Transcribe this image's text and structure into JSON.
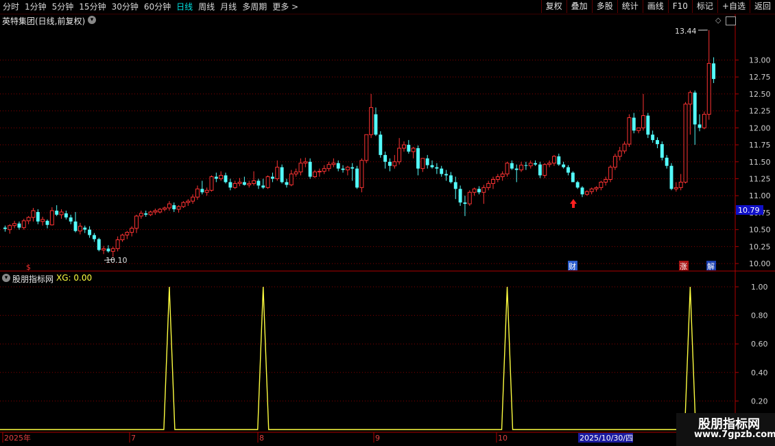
{
  "toolbar": {
    "periods": [
      "分时",
      "1分钟",
      "5分钟",
      "15分钟",
      "30分钟",
      "60分钟",
      "日线",
      "周线",
      "月线",
      "多周期",
      "更多 >"
    ],
    "active_period": "日线",
    "buttons": [
      "复权",
      "叠加",
      "多股",
      "统计",
      "画线",
      "F10",
      "标记",
      "+自选",
      "返回"
    ]
  },
  "stock": {
    "title": "英特集团(日线,前复权)"
  },
  "price_axis": {
    "ticks": [
      "13.00",
      "12.75",
      "12.50",
      "12.25",
      "12.00",
      "11.75",
      "11.50",
      "11.25",
      "11.00",
      "10.75",
      "10.50",
      "10.25",
      "10.00"
    ],
    "current": "10.79"
  },
  "annotations": {
    "high_label": "13.44",
    "low_label": "10.10"
  },
  "markers": [
    "财",
    "涨",
    "解"
  ],
  "red_icon_glyph": "$",
  "indicator": {
    "name": "股朋指标网",
    "xg_label": "XG: 0.00",
    "ticks": [
      "1.00",
      "0.80",
      "0.60",
      "0.40",
      "0.20"
    ]
  },
  "time_axis": {
    "labels": [
      "2025年",
      "7",
      "8",
      "9",
      "10"
    ],
    "selected_date": "2025/10/30/四"
  },
  "watermark": {
    "line1": "股朋指标网",
    "line2": "www.7gpzb.com"
  },
  "colors": {
    "up": "#ff3333",
    "down": "#54fcfc",
    "indicator": "#ffff40",
    "grid": "#8b0000",
    "bg": "#000000"
  },
  "chart_data": {
    "type": "candlestick",
    "price_range": [
      9.9,
      13.5
    ],
    "indicator_range": [
      0,
      1
    ],
    "indicator_spikes": [
      35,
      55,
      107,
      146
    ],
    "candles": [
      [
        10.53,
        10.56,
        10.47,
        10.51
      ],
      [
        10.5,
        10.58,
        10.44,
        10.56
      ],
      [
        10.56,
        10.63,
        10.52,
        10.59
      ],
      [
        10.59,
        10.62,
        10.5,
        10.53
      ],
      [
        10.53,
        10.66,
        10.5,
        10.63
      ],
      [
        10.63,
        10.7,
        10.58,
        10.68
      ],
      [
        10.68,
        10.82,
        10.62,
        10.78
      ],
      [
        10.76,
        10.8,
        10.58,
        10.62
      ],
      [
        10.62,
        10.69,
        10.56,
        10.65
      ],
      [
        10.63,
        10.65,
        10.52,
        10.57
      ],
      [
        10.57,
        10.83,
        10.56,
        10.78
      ],
      [
        10.78,
        10.86,
        10.7,
        10.72
      ],
      [
        10.72,
        10.8,
        10.66,
        10.76
      ],
      [
        10.74,
        10.78,
        10.65,
        10.68
      ],
      [
        10.68,
        10.72,
        10.58,
        10.62
      ],
      [
        10.62,
        10.76,
        10.46,
        10.48
      ],
      [
        10.48,
        10.6,
        10.43,
        10.55
      ],
      [
        10.53,
        10.56,
        10.45,
        10.5
      ],
      [
        10.5,
        10.55,
        10.38,
        10.42
      ],
      [
        10.42,
        10.45,
        10.32,
        10.36
      ],
      [
        10.36,
        10.38,
        10.18,
        10.2
      ],
      [
        10.2,
        10.26,
        10.14,
        10.22
      ],
      [
        10.22,
        10.27,
        10.16,
        10.18
      ],
      [
        10.18,
        10.25,
        10.1,
        10.22
      ],
      [
        10.22,
        10.4,
        10.18,
        10.35
      ],
      [
        10.35,
        10.44,
        10.32,
        10.42
      ],
      [
        10.42,
        10.48,
        10.36,
        10.46
      ],
      [
        10.46,
        10.55,
        10.4,
        10.52
      ],
      [
        10.52,
        10.72,
        10.45,
        10.7
      ],
      [
        10.7,
        10.78,
        10.66,
        10.74
      ],
      [
        10.74,
        10.78,
        10.69,
        10.72
      ],
      [
        10.72,
        10.78,
        10.7,
        10.76
      ],
      [
        10.76,
        10.81,
        10.72,
        10.78
      ],
      [
        10.76,
        10.82,
        10.74,
        10.8
      ],
      [
        10.8,
        10.84,
        10.77,
        10.82
      ],
      [
        10.82,
        10.92,
        10.78,
        10.88
      ],
      [
        10.86,
        10.9,
        10.76,
        10.8
      ],
      [
        10.8,
        10.86,
        10.75,
        10.84
      ],
      [
        10.84,
        10.92,
        10.82,
        10.9
      ],
      [
        10.9,
        10.95,
        10.85,
        10.92
      ],
      [
        10.92,
        11.02,
        10.88,
        10.98
      ],
      [
        10.98,
        11.15,
        10.94,
        11.1
      ],
      [
        11.1,
        11.22,
        11.02,
        11.05
      ],
      [
        11.05,
        11.12,
        11.0,
        11.08
      ],
      [
        11.08,
        11.3,
        11.06,
        11.28
      ],
      [
        11.28,
        11.34,
        11.2,
        11.25
      ],
      [
        11.25,
        11.36,
        11.22,
        11.3
      ],
      [
        11.3,
        11.34,
        11.18,
        11.2
      ],
      [
        11.2,
        11.25,
        11.08,
        11.12
      ],
      [
        11.12,
        11.22,
        11.1,
        11.18
      ],
      [
        11.18,
        11.26,
        11.14,
        11.2
      ],
      [
        11.2,
        11.28,
        11.15,
        11.16
      ],
      [
        11.16,
        11.22,
        11.12,
        11.18
      ],
      [
        11.18,
        11.36,
        11.15,
        11.22
      ],
      [
        11.22,
        11.25,
        11.1,
        11.15
      ],
      [
        11.15,
        11.25,
        11.1,
        11.12
      ],
      [
        11.12,
        11.3,
        11.1,
        11.28
      ],
      [
        11.28,
        11.34,
        11.2,
        11.25
      ],
      [
        11.25,
        11.52,
        11.22,
        11.42
      ],
      [
        11.42,
        11.46,
        11.18,
        11.2
      ],
      [
        11.2,
        11.25,
        11.12,
        11.16
      ],
      [
        11.16,
        11.38,
        11.14,
        11.32
      ],
      [
        11.32,
        11.4,
        11.28,
        11.35
      ],
      [
        11.35,
        11.55,
        11.3,
        11.48
      ],
      [
        11.48,
        11.56,
        11.42,
        11.5
      ],
      [
        11.5,
        11.55,
        11.25,
        11.28
      ],
      [
        11.28,
        11.38,
        11.26,
        11.35
      ],
      [
        11.35,
        11.4,
        11.28,
        11.36
      ],
      [
        11.36,
        11.45,
        11.32,
        11.4
      ],
      [
        11.4,
        11.5,
        11.36,
        11.46
      ],
      [
        11.46,
        11.55,
        11.42,
        11.48
      ],
      [
        11.48,
        11.52,
        11.36,
        11.4
      ],
      [
        11.4,
        11.45,
        11.34,
        11.38
      ],
      [
        11.38,
        11.44,
        11.3,
        11.42
      ],
      [
        11.42,
        11.48,
        11.22,
        11.4
      ],
      [
        11.4,
        11.44,
        11.1,
        11.12
      ],
      [
        11.12,
        11.55,
        11.05,
        11.52
      ],
      [
        11.52,
        11.62,
        11.48,
        11.9
      ],
      [
        11.9,
        12.5,
        11.85,
        12.3
      ],
      [
        12.2,
        12.3,
        11.88,
        11.9
      ],
      [
        11.9,
        11.95,
        11.56,
        11.6
      ],
      [
        11.6,
        11.65,
        11.4,
        11.5
      ],
      [
        11.5,
        11.55,
        11.36,
        11.44
      ],
      [
        11.44,
        11.6,
        11.4,
        11.5
      ],
      [
        11.5,
        11.85,
        11.46,
        11.7
      ],
      [
        11.7,
        11.8,
        11.65,
        11.75
      ],
      [
        11.75,
        11.82,
        11.62,
        11.65
      ],
      [
        11.65,
        11.72,
        11.55,
        11.7
      ],
      [
        11.7,
        11.74,
        11.3,
        11.4
      ],
      [
        11.4,
        11.5,
        11.35,
        11.55
      ],
      [
        11.55,
        11.6,
        11.4,
        11.45
      ],
      [
        11.45,
        11.52,
        11.4,
        11.42
      ],
      [
        11.42,
        11.48,
        11.32,
        11.4
      ],
      [
        11.4,
        11.44,
        11.28,
        11.32
      ],
      [
        11.32,
        11.38,
        11.22,
        11.3
      ],
      [
        11.3,
        11.35,
        11.18,
        11.2
      ],
      [
        11.2,
        11.28,
        10.95,
        11.1
      ],
      [
        11.1,
        11.15,
        10.85,
        10.9
      ],
      [
        10.9,
        11.0,
        10.7,
        10.88
      ],
      [
        10.88,
        11.08,
        10.85,
        11.05
      ],
      [
        11.05,
        11.12,
        11.0,
        11.1
      ],
      [
        11.1,
        11.14,
        11.02,
        11.05
      ],
      [
        11.05,
        11.16,
        10.88,
        11.12
      ],
      [
        11.12,
        11.22,
        11.08,
        11.18
      ],
      [
        11.18,
        11.28,
        11.1,
        11.24
      ],
      [
        11.24,
        11.32,
        11.2,
        11.28
      ],
      [
        11.28,
        11.36,
        11.22,
        11.32
      ],
      [
        11.32,
        11.5,
        11.28,
        11.48
      ],
      [
        11.48,
        11.52,
        11.38,
        11.4
      ],
      [
        11.4,
        11.46,
        11.2,
        11.38
      ],
      [
        11.38,
        11.5,
        11.35,
        11.45
      ],
      [
        11.45,
        11.5,
        11.38,
        11.44
      ],
      [
        11.44,
        11.52,
        11.4,
        11.48
      ],
      [
        11.48,
        11.52,
        11.44,
        11.46
      ],
      [
        11.46,
        11.5,
        11.26,
        11.3
      ],
      [
        11.3,
        11.48,
        11.26,
        11.46
      ],
      [
        11.46,
        11.52,
        11.42,
        11.48
      ],
      [
        11.48,
        11.6,
        11.44,
        11.58
      ],
      [
        11.58,
        11.62,
        11.44,
        11.46
      ],
      [
        11.46,
        11.5,
        11.4,
        11.42
      ],
      [
        11.42,
        11.45,
        11.3,
        11.34
      ],
      [
        11.34,
        11.36,
        11.22,
        11.2
      ],
      [
        11.2,
        11.22,
        11.1,
        11.12
      ],
      [
        11.12,
        11.14,
        10.98,
        11.02
      ],
      [
        11.02,
        11.08,
        11.0,
        11.06
      ],
      [
        11.06,
        11.12,
        11.02,
        11.1
      ],
      [
        11.1,
        11.14,
        11.06,
        11.12
      ],
      [
        11.12,
        11.22,
        11.08,
        11.2
      ],
      [
        11.2,
        11.28,
        11.15,
        11.24
      ],
      [
        11.24,
        11.45,
        11.2,
        11.42
      ],
      [
        11.42,
        11.62,
        11.38,
        11.58
      ],
      [
        11.58,
        11.72,
        11.52,
        11.66
      ],
      [
        11.66,
        11.8,
        11.62,
        11.76
      ],
      [
        11.76,
        12.2,
        11.72,
        12.15
      ],
      [
        12.15,
        12.22,
        11.92,
        11.96
      ],
      [
        11.96,
        12.0,
        11.92,
        12.0
      ],
      [
        12.0,
        12.5,
        11.96,
        12.18
      ],
      [
        12.18,
        12.22,
        11.85,
        11.9
      ],
      [
        11.9,
        11.96,
        11.78,
        11.82
      ],
      [
        11.82,
        11.86,
        11.7,
        11.76
      ],
      [
        11.76,
        11.8,
        11.52,
        11.56
      ],
      [
        11.56,
        11.6,
        11.4,
        11.44
      ],
      [
        11.44,
        11.48,
        11.08,
        11.1
      ],
      [
        11.1,
        11.2,
        11.06,
        11.12
      ],
      [
        11.12,
        11.32,
        11.08,
        11.2
      ],
      [
        11.2,
        12.38,
        11.18,
        12.35
      ],
      [
        12.35,
        12.55,
        11.9,
        12.52
      ],
      [
        12.52,
        12.55,
        11.75,
        12.05
      ],
      [
        12.05,
        12.2,
        11.95,
        12.0
      ],
      [
        12.0,
        12.24,
        11.98,
        12.2
      ],
      [
        12.2,
        13.44,
        12.12,
        12.95
      ],
      [
        12.95,
        13.04,
        12.66,
        12.72
      ]
    ]
  }
}
